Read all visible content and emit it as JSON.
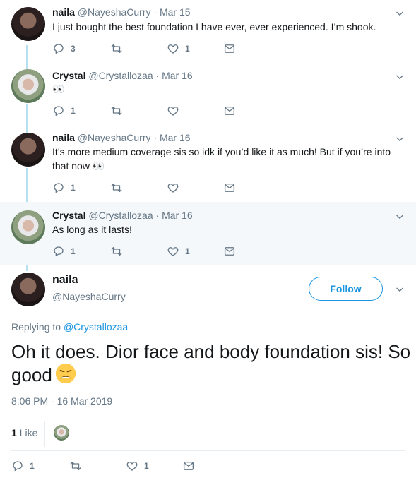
{
  "replies": [
    {
      "author": "naila",
      "handle": "@NayeshaCurry",
      "separator": "·",
      "date": "Mar 15",
      "text": "I just bought the best foundation I have ever, ever experienced. I’m shook.",
      "reply_count": "3",
      "retweet_count": "",
      "like_count": "1"
    },
    {
      "author": "Crystal",
      "handle": "@Crystallozaa",
      "separator": "·",
      "date": "Mar 16",
      "text": "👀",
      "reply_count": "1",
      "retweet_count": "",
      "like_count": ""
    },
    {
      "author": "naila",
      "handle": "@NayeshaCurry",
      "separator": "·",
      "date": "Mar 16",
      "text": "It’s more medium coverage sis so idk if you’d like it as much! But if you’re into that now 👀",
      "reply_count": "1",
      "retweet_count": "",
      "like_count": ""
    },
    {
      "author": "Crystal",
      "handle": "@Crystallozaa",
      "separator": "·",
      "date": "Mar 16",
      "text": "As long as it lasts!",
      "reply_count": "1",
      "retweet_count": "",
      "like_count": "1"
    }
  ],
  "main_tweet": {
    "author": "naila",
    "handle": "@NayeshaCurry",
    "follow_label": "Follow",
    "replying_prefix": "Replying to",
    "replying_to": "@Crystallozaa",
    "text": "Oh it does. Dior face and body foundation sis! So good",
    "timestamp": "8:06 PM - 16 Mar 2019",
    "likes_count": "1",
    "likes_label": "Like",
    "reply_count": "1",
    "retweet_count": "",
    "like_count": "1"
  },
  "colors": {
    "accent": "#1b95e0",
    "muted": "#657786",
    "thread_line": "#b6e0f2",
    "highlight_bg": "#f5f8fa"
  },
  "icons": [
    "reply-icon",
    "retweet-icon",
    "heart-icon",
    "message-icon",
    "chevron-down-icon",
    "weary-face-emoji"
  ]
}
